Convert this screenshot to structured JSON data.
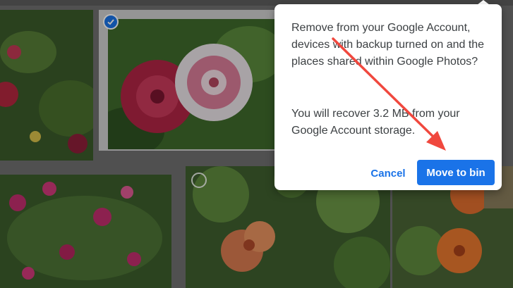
{
  "dialog": {
    "message": "Remove from your Google Account, devices with backup turned on and the places shared within Google Photos?",
    "recover_note": "You will recover 3.2 MB from your Google Account storage.",
    "cancel_label": "Cancel",
    "confirm_label": "Move to bin"
  },
  "photos": [
    {
      "subject": "flower-photo",
      "selected": false
    },
    {
      "subject": "dahlia-photo",
      "selected": true
    },
    {
      "subject": "dianthus-photo",
      "selected": false
    },
    {
      "subject": "nasturtium-photo",
      "selected": false
    },
    {
      "subject": "nasturtium-photo-2",
      "selected": false
    }
  ],
  "colors": {
    "accent": "#1a73e8",
    "annotation_arrow": "#f0483e"
  },
  "icons": {
    "selected_check": "check-circle-icon",
    "unselected": "circle-outline-icon"
  }
}
